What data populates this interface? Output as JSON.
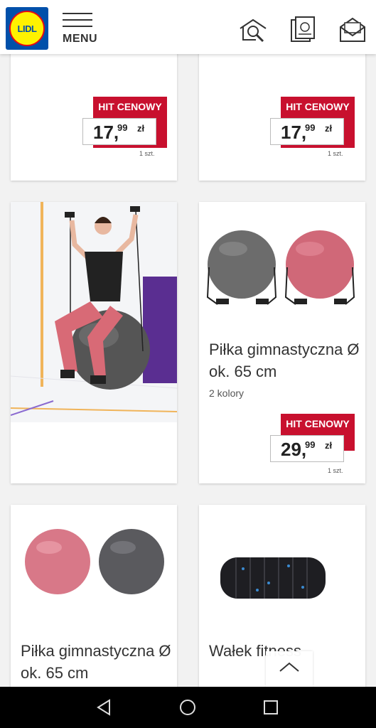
{
  "header": {
    "logo_text": "LIDL",
    "menu_label": "MENU",
    "icons": [
      "search-house-icon",
      "leaflet-icon",
      "newsletter-icon"
    ]
  },
  "products": [
    {
      "badge": "HIT CENOWY",
      "price_int": "17,",
      "price_dec": "99",
      "currency": "zł",
      "unit": "1 szt."
    },
    {
      "badge": "HIT CENOWY",
      "price_int": "17,",
      "price_dec": "99",
      "currency": "zł",
      "unit": "1 szt."
    },
    {
      "image": "woman-on-fitness-ball-photo"
    },
    {
      "title_line1": "Piłka gimnastyczna Ø",
      "title_line2": "ok. 65 cm",
      "subtitle": "2 kolory",
      "badge": "HIT CENOWY",
      "price_int": "29,",
      "price_dec": "99",
      "currency": "zł",
      "unit": "1 szt."
    },
    {
      "title_line1": "Piłka gimnastyczna Ø",
      "title_line2": "ok. 65 cm"
    },
    {
      "title_line1": "Wałek fitness"
    }
  ],
  "colors": {
    "accent_red": "#c8102e",
    "brand_blue": "#0050aa",
    "brand_yellow": "#fff200"
  }
}
